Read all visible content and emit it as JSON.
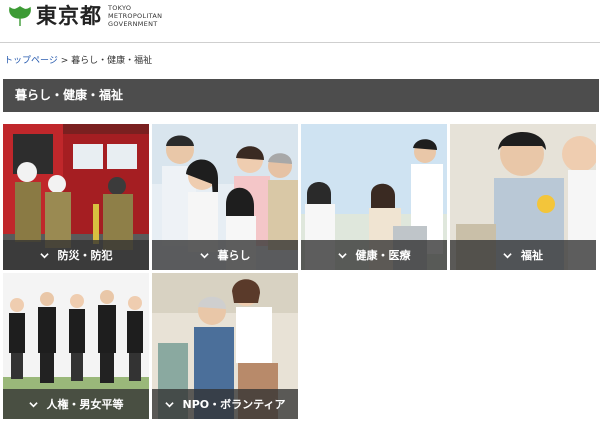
{
  "header": {
    "logo_text": "東京都",
    "logo_sub_line1": "TOKYO METROPOLITAN",
    "logo_sub_line2": "GOVERNMENT",
    "brand_color": "#3d9b35"
  },
  "breadcrumb": {
    "home": "トップページ",
    "separator": ">",
    "current": "暮らし・健康・福祉"
  },
  "section": {
    "title": "暮らし・健康・福祉"
  },
  "tiles": [
    {
      "label": "防災・防犯",
      "icon": "chevron-down-icon"
    },
    {
      "label": "暮らし",
      "icon": "chevron-down-icon"
    },
    {
      "label": "健康・医療",
      "icon": "chevron-down-icon"
    },
    {
      "label": "福祉",
      "icon": "chevron-down-icon"
    },
    {
      "label": "人権・男女平等",
      "icon": "chevron-down-icon"
    },
    {
      "label": "NPO・ボランティア",
      "icon": "chevron-down-icon"
    }
  ],
  "colors": {
    "title_bar": "#4d4d4d",
    "link": "#2a5db0",
    "tile_bar": "#323232"
  }
}
